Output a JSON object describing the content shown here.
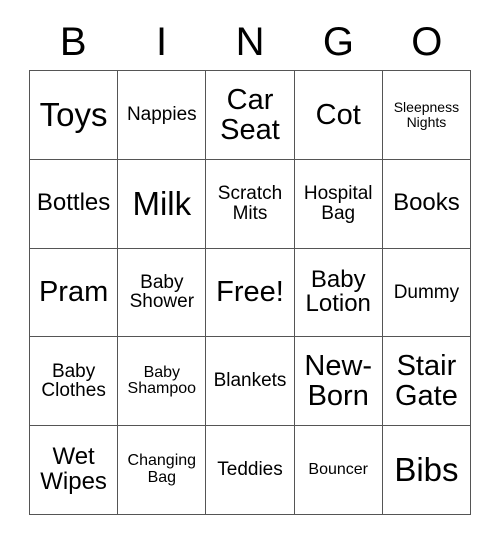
{
  "header": {
    "letters": [
      "B",
      "I",
      "N",
      "G",
      "O"
    ]
  },
  "grid": {
    "rows": 5,
    "columns": 5,
    "cells": [
      [
        {
          "label": "Toys",
          "size": "fs-xl"
        },
        {
          "label": "Nappies",
          "size": "fs-sm"
        },
        {
          "label": "Car Seat",
          "size": "fs-lg"
        },
        {
          "label": "Cot",
          "size": "fs-lg"
        },
        {
          "label": "Sleepness Nights",
          "size": "fs-xxs"
        }
      ],
      [
        {
          "label": "Bottles",
          "size": "fs-md"
        },
        {
          "label": "Milk",
          "size": "fs-xl"
        },
        {
          "label": "Scratch Mits",
          "size": "fs-sm"
        },
        {
          "label": "Hospital Bag",
          "size": "fs-sm"
        },
        {
          "label": "Books",
          "size": "fs-md"
        }
      ],
      [
        {
          "label": "Pram",
          "size": "fs-lg"
        },
        {
          "label": "Baby Shower",
          "size": "fs-sm"
        },
        {
          "label": "Free!",
          "size": "fs-lg"
        },
        {
          "label": "Baby Lotion",
          "size": "fs-md"
        },
        {
          "label": "Dummy",
          "size": "fs-sm"
        }
      ],
      [
        {
          "label": "Baby Clothes",
          "size": "fs-sm"
        },
        {
          "label": "Baby Shampoo",
          "size": "fs-xs"
        },
        {
          "label": "Blankets",
          "size": "fs-sm"
        },
        {
          "label": "New-Born",
          "size": "fs-lg"
        },
        {
          "label": "Stair Gate",
          "size": "fs-lg"
        }
      ],
      [
        {
          "label": "Wet Wipes",
          "size": "fs-md"
        },
        {
          "label": "Changing Bag",
          "size": "fs-xs"
        },
        {
          "label": "Teddies",
          "size": "fs-sm"
        },
        {
          "label": "Bouncer",
          "size": "fs-xs"
        },
        {
          "label": "Bibs",
          "size": "fs-xl"
        }
      ]
    ]
  },
  "colors": {
    "border": "#555555",
    "text": "#000000",
    "background": "#ffffff"
  }
}
